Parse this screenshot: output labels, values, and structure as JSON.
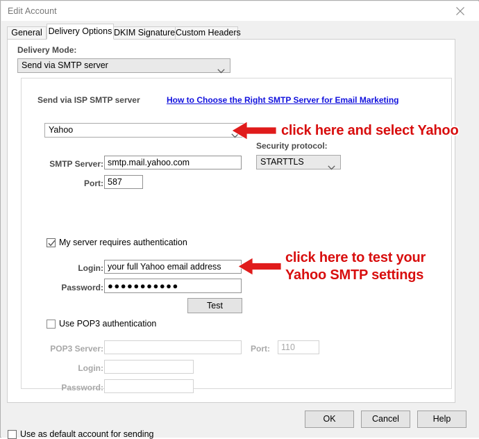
{
  "window": {
    "title": "Edit Account",
    "close_icon": "close-icon"
  },
  "tabs": [
    {
      "label": "General",
      "active": false
    },
    {
      "label": "Delivery Options",
      "active": true
    },
    {
      "label": "DKIM Signature",
      "active": false
    },
    {
      "label": "Custom Headers",
      "active": false
    }
  ],
  "delivery": {
    "mode_label": "Delivery Mode:",
    "mode_value": "Send via SMTP server",
    "group_title": "Send via ISP SMTP server",
    "help_link": "How to Choose the Right SMTP Server for Email Marketing",
    "provider_value": "Yahoo",
    "security_label": "Security protocol:",
    "security_value": "STARTTLS",
    "smtp_server_label": "SMTP Server:",
    "smtp_server_value": "smtp.mail.yahoo.com",
    "port_label": "Port:",
    "port_value": "587",
    "auth_checkbox_label": "My server requires authentication",
    "auth_checked": true,
    "login_label": "Login:",
    "login_value": "your full Yahoo email address",
    "password_label": "Password:",
    "password_value": "●●●●●●●●●●●",
    "test_button": "Test"
  },
  "pop3": {
    "checkbox_label": "Use POP3 authentication",
    "checked": false,
    "server_label": "POP3 Server:",
    "server_value": "",
    "port_label": "Port:",
    "port_value": "110",
    "login_label": "Login:",
    "login_value": "",
    "password_label": "Password:",
    "password_value": ""
  },
  "footer": {
    "default_account_label": "Use as default account for sending",
    "default_account_checked": false,
    "ok": "OK",
    "cancel": "Cancel",
    "help": "Help"
  },
  "annotations": {
    "arrow1_text": "click here and select Yahoo",
    "arrow2_text_line1": "click here to test your",
    "arrow2_text_line2": "Yahoo SMTP settings",
    "color": "#d80e0e"
  }
}
